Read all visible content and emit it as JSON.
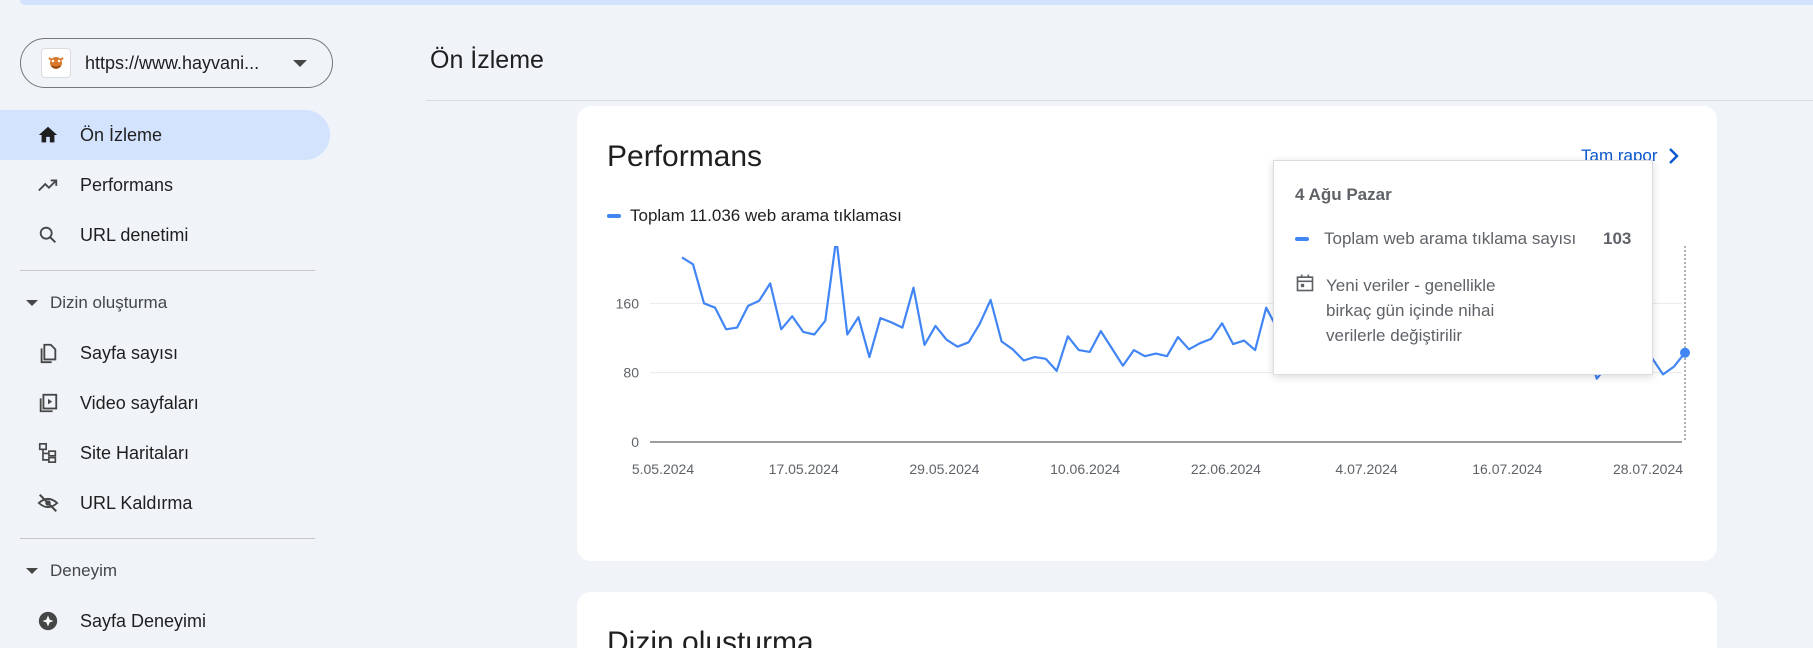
{
  "property": {
    "url": "https://www.hayvani..."
  },
  "sidebar": {
    "items": [
      {
        "label": "Ön İzleme",
        "icon": "home-icon"
      },
      {
        "label": "Performans",
        "icon": "trending-up-icon"
      },
      {
        "label": "URL denetimi",
        "icon": "search-icon"
      }
    ],
    "sections": [
      {
        "label": "Dizin oluşturma",
        "items": [
          {
            "label": "Sayfa sayısı",
            "icon": "pages-icon"
          },
          {
            "label": "Video sayfaları",
            "icon": "video-pages-icon"
          },
          {
            "label": "Site Haritaları",
            "icon": "sitemap-icon"
          },
          {
            "label": "URL Kaldırma",
            "icon": "visibility-off-icon"
          }
        ]
      },
      {
        "label": "Deneyim",
        "items": [
          {
            "label": "Sayfa Deneyimi",
            "icon": "page-experience-icon"
          }
        ]
      }
    ]
  },
  "page": {
    "title": "Ön İzleme"
  },
  "performance": {
    "title": "Performans",
    "full_report": "Tam rapor",
    "legend": "Toplam 11.036 web arama tıklaması"
  },
  "tooltip": {
    "date": "4 Ağu Pazar",
    "metric": "Toplam web arama tıklama sayısı",
    "value": "103",
    "note": "Yeni veriler - genellikle birkaç gün içinde nihai verilerle değiştirilir"
  },
  "next_card": {
    "title": "Dizin oluşturma"
  },
  "colors": {
    "accent": "#4285f4",
    "active_nav": "#d3e3fd",
    "link": "#0b57d0"
  },
  "chart_data": {
    "type": "line",
    "ylim": [
      0,
      240
    ],
    "yticks": [
      "0",
      "80",
      "160",
      "240"
    ],
    "xtick_labels": [
      "5.05.2024",
      "17.05.2024",
      "29.05.2024",
      "10.06.2024",
      "22.06.2024",
      "4.07.2024",
      "16.07.2024",
      "28.07.2024"
    ],
    "x_start": "5.05.2024",
    "x_end": "4.08.2024",
    "series": [
      {
        "values": [
          213,
          205,
          160,
          155,
          130,
          132,
          157,
          163,
          183,
          130,
          145,
          127,
          124,
          140,
          235,
          124,
          144,
          98,
          143,
          138,
          132,
          178,
          112,
          134,
          118,
          110,
          115,
          136,
          164,
          116,
          107,
          94,
          98,
          96,
          82,
          122,
          106,
          104,
          128,
          108,
          88,
          106,
          99,
          102,
          99,
          121,
          107,
          114,
          119,
          137,
          113,
          117,
          106,
          155,
          131,
          104,
          118,
          130,
          111,
          133,
          118,
          111,
          99,
          126,
          155,
          108,
          114,
          145,
          132,
          108,
          101,
          90,
          150,
          116,
          90,
          84,
          88,
          87,
          89,
          89,
          84,
          110,
          112,
          73,
          89,
          112,
          92,
          88,
          97,
          78,
          87,
          103
        ]
      }
    ]
  }
}
